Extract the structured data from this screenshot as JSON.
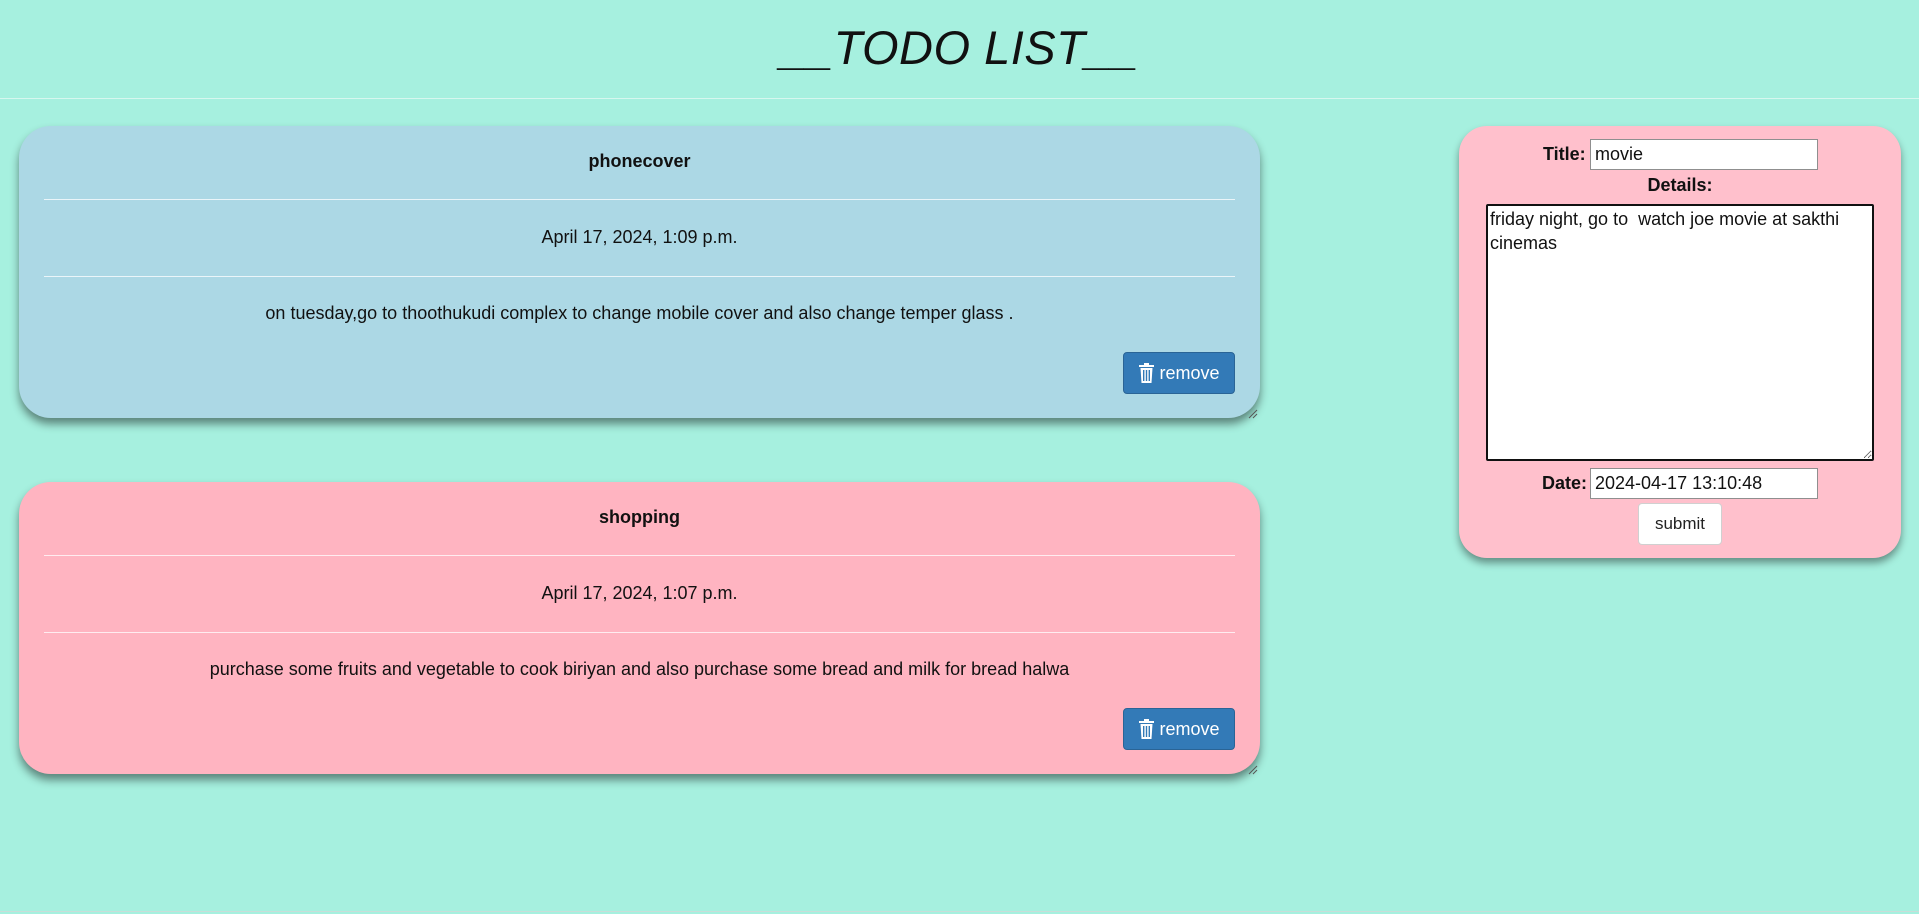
{
  "header": {
    "title": "__TODO LIST__"
  },
  "todos": [
    {
      "title": "phonecover",
      "date": "April 17, 2024, 1:09 p.m.",
      "details": "on tuesday,go to thoothukudi complex to change mobile cover and also change temper glass .",
      "remove_label": "remove",
      "color": "#acd8e5"
    },
    {
      "title": "shopping",
      "date": "April 17, 2024, 1:07 p.m.",
      "details": "purchase some fruits and vegetable to cook biriyan and also purchase some bread and milk for bread halwa",
      "remove_label": "remove",
      "color": "#ffb4c1"
    }
  ],
  "form": {
    "title_label": "Title:",
    "title_value": "movie",
    "details_label": "Details:",
    "details_value": "friday night, go to  watch joe movie at sakthi cinemas",
    "date_label": "Date:",
    "date_value": "2024-04-17 13:10:48",
    "submit_label": "submit",
    "panel_color": "#ffc0cc"
  },
  "colors": {
    "background": "#a6f0df",
    "button": "#337ab7"
  },
  "icons": {
    "remove": "trash-icon"
  }
}
